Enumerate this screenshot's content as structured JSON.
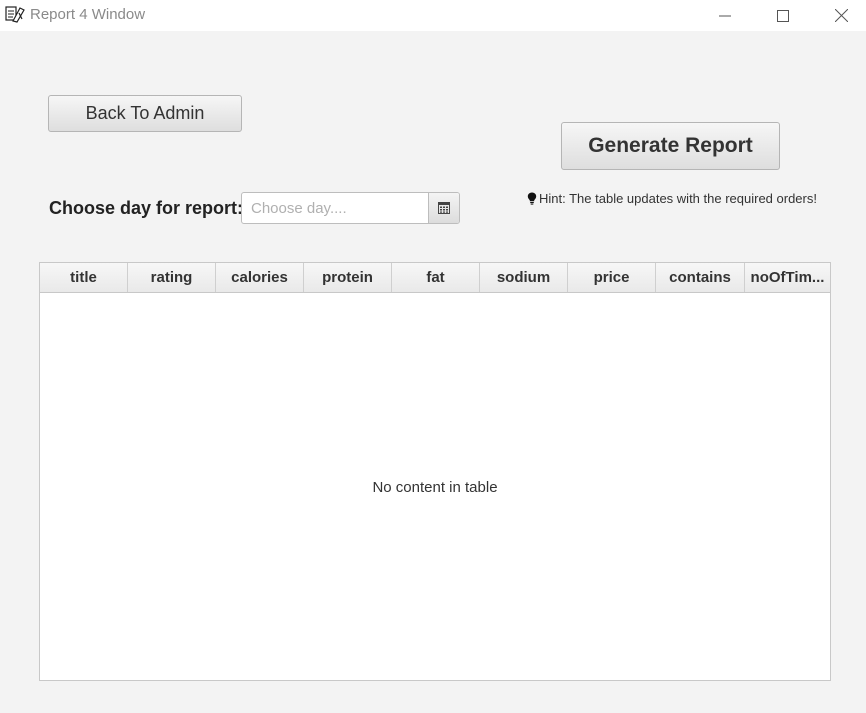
{
  "window": {
    "title": "Report 4 Window",
    "icons": [
      "app-icon",
      "minimize-icon",
      "maximize-icon",
      "close-icon"
    ]
  },
  "controls": {
    "back_label": "Back To Admin",
    "generate_label": "Generate Report",
    "day_label": "Choose day for report:",
    "date_placeholder": "Choose day....",
    "date_value": "",
    "calendar_icon": "calendar-icon"
  },
  "hint": {
    "icon": "lightbulb-icon",
    "text": "Hint: The table updates with the required orders!"
  },
  "table": {
    "columns": [
      "title",
      "rating",
      "calories",
      "protein",
      "fat",
      "sodium",
      "price",
      "contains",
      "noOfTim..."
    ],
    "rows": [],
    "empty_text": "No content in table"
  }
}
